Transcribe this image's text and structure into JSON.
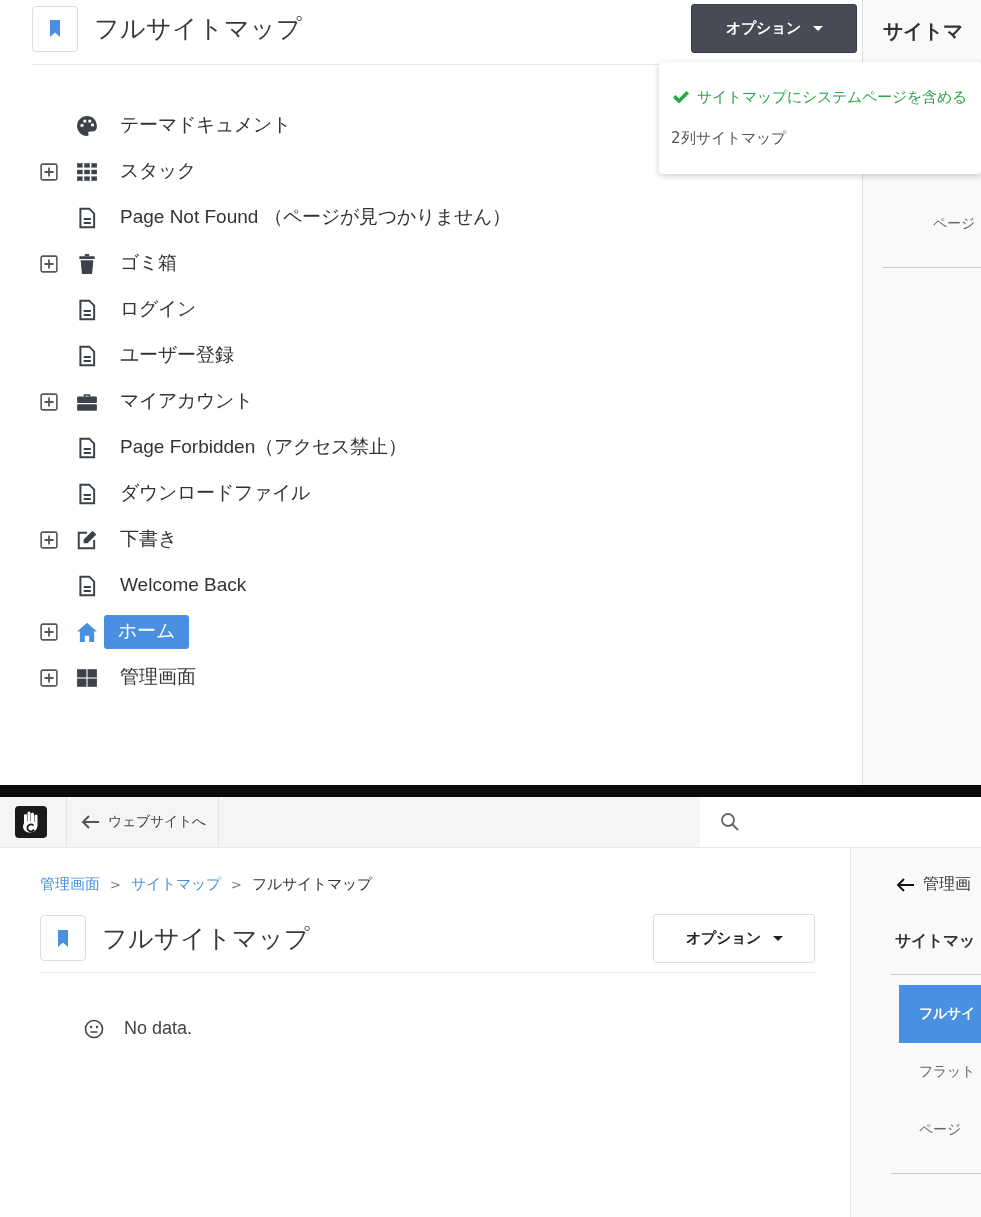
{
  "top_panel": {
    "title": "フルサイトマップ",
    "options_button": "オプション",
    "options_menu": [
      {
        "label": "サイトマップにシステムページを含める",
        "checked": true
      },
      {
        "label": "2列サイトマップ",
        "checked": false
      }
    ],
    "tree": [
      {
        "kind": "palette",
        "label": "テーマドキュメント",
        "expandable": false,
        "selected": false
      },
      {
        "kind": "grid",
        "label": "スタック",
        "expandable": true,
        "expanded": false,
        "selected": false
      },
      {
        "kind": "page",
        "label": "Page Not Found （ページが見つかりません）",
        "expandable": false,
        "selected": false
      },
      {
        "kind": "trash",
        "label": "ゴミ箱",
        "expandable": true,
        "expanded": false,
        "selected": false
      },
      {
        "kind": "page",
        "label": "ログイン",
        "expandable": false,
        "selected": false
      },
      {
        "kind": "page",
        "label": "ユーザー登録",
        "expandable": false,
        "selected": false
      },
      {
        "kind": "briefcase",
        "label": "マイアカウント",
        "expandable": true,
        "expanded": false,
        "selected": false
      },
      {
        "kind": "page",
        "label": "Page Forbidden（アクセス禁止）",
        "expandable": false,
        "selected": false
      },
      {
        "kind": "page",
        "label": "ダウンロードファイル",
        "expandable": false,
        "selected": false
      },
      {
        "kind": "edit",
        "label": "下書き",
        "expandable": true,
        "expanded": false,
        "selected": false
      },
      {
        "kind": "page",
        "label": "Welcome Back",
        "expandable": false,
        "selected": false
      },
      {
        "kind": "home",
        "label": "ホーム",
        "expandable": true,
        "expanded": false,
        "selected": true
      },
      {
        "kind": "dashboard",
        "label": "管理画面",
        "expandable": true,
        "expanded": false,
        "selected": false
      }
    ],
    "sidebar": {
      "heading": "サイトマ",
      "items": [
        {
          "label": "ページ",
          "selected": false
        }
      ]
    }
  },
  "bottom_panel": {
    "toolbar": {
      "back_link": "ウェブサイトへ"
    },
    "breadcrumbs": [
      {
        "kind": "link",
        "label": "管理画面"
      },
      {
        "kind": "separator",
        "label": ">"
      },
      {
        "kind": "link",
        "label": "サイトマップ"
      },
      {
        "kind": "separator",
        "label": ">"
      },
      {
        "kind": "current",
        "label": "フルサイトマップ"
      }
    ],
    "title": "フルサイトマップ",
    "options_button": "オプション",
    "empty_message": "No data.",
    "sidebar": {
      "back_link": "管理画",
      "heading": "サイトマッ",
      "items": [
        {
          "label": "フルサイ",
          "selected": true
        },
        {
          "label": "フラット",
          "selected": false
        },
        {
          "label": "ページ",
          "selected": false
        }
      ]
    }
  }
}
